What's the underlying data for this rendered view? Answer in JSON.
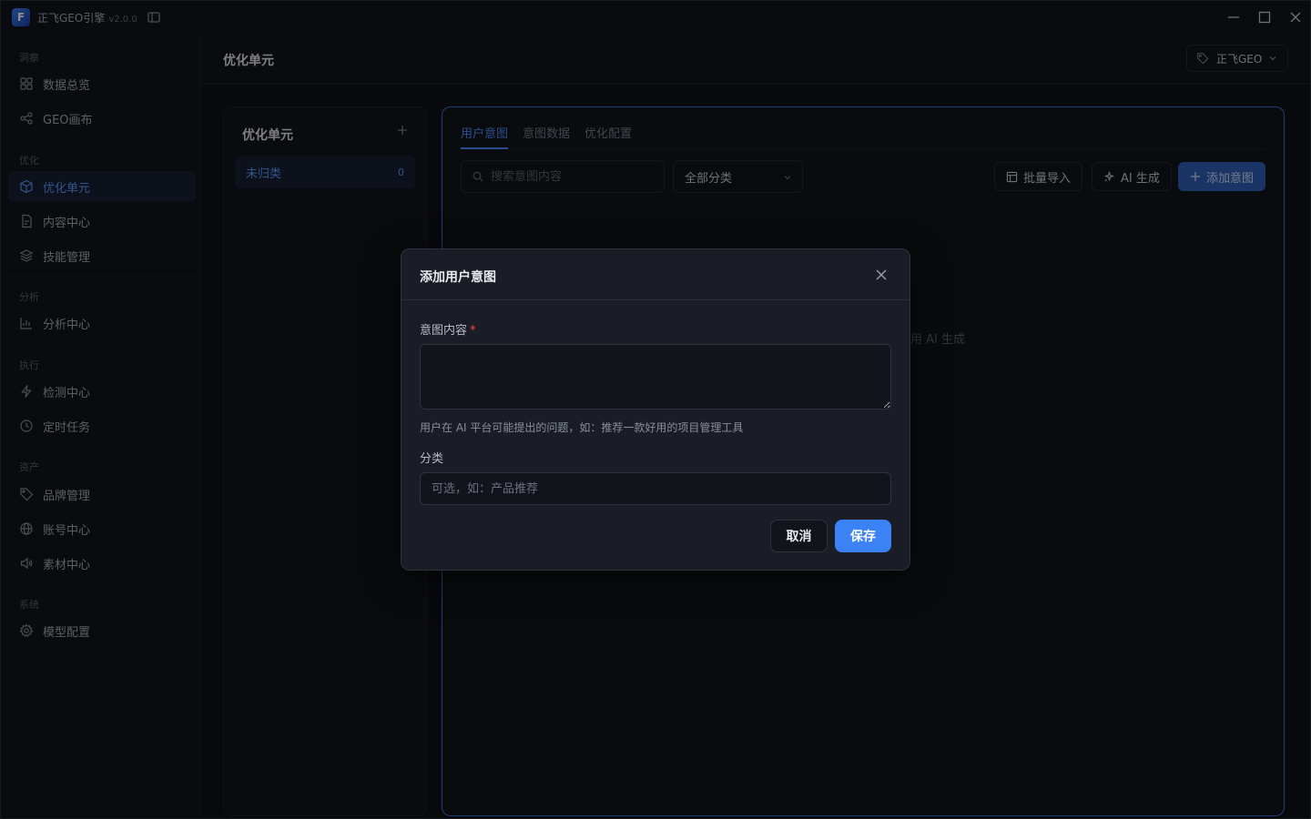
{
  "app": {
    "title": "正飞GEO引擎",
    "version": "v2.0.0",
    "logo_letter": "F"
  },
  "colors": {
    "accent": "#3b82f6",
    "bg": "#0f1117",
    "panel": "#12141b",
    "required": "#ef4444"
  },
  "sidebar": {
    "sections": [
      {
        "label": "洞察",
        "items": [
          {
            "label": "数据总览",
            "icon": "grid-icon"
          },
          {
            "label": "GEO画布",
            "icon": "share-nodes-icon"
          }
        ]
      },
      {
        "label": "优化",
        "items": [
          {
            "label": "优化单元",
            "icon": "cube-icon",
            "active": true
          },
          {
            "label": "内容中心",
            "icon": "document-icon"
          },
          {
            "label": "技能管理",
            "icon": "layers-icon"
          }
        ]
      },
      {
        "label": "分析",
        "items": [
          {
            "label": "分析中心",
            "icon": "bar-chart-icon"
          }
        ]
      },
      {
        "label": "执行",
        "items": [
          {
            "label": "检测中心",
            "icon": "bolt-icon"
          },
          {
            "label": "定时任务",
            "icon": "clock-icon"
          }
        ]
      },
      {
        "label": "资产",
        "items": [
          {
            "label": "品牌管理",
            "icon": "tag-icon"
          },
          {
            "label": "账号中心",
            "icon": "globe-icon"
          },
          {
            "label": "素材中心",
            "icon": "speaker-icon"
          }
        ]
      },
      {
        "label": "系统",
        "items": [
          {
            "label": "模型配置",
            "icon": "gear-icon"
          }
        ]
      }
    ]
  },
  "header": {
    "title": "优化单元",
    "brand_select": "正飞GEO"
  },
  "units_panel": {
    "title": "优化单元",
    "items": [
      {
        "label": "未归类",
        "count": "0"
      }
    ]
  },
  "main": {
    "tabs": [
      {
        "label": "用户意图",
        "active": true
      },
      {
        "label": "意图数据"
      },
      {
        "label": "优化配置"
      }
    ],
    "search_placeholder": "搜索意图内容",
    "category_select": "全部分类",
    "batch_import": "批量导入",
    "ai_generate": "AI 生成",
    "add_intent": "添加意图",
    "empty_hint_partial": "用 AI 生成"
  },
  "modal": {
    "title": "添加用户意图",
    "content_label": "意图内容",
    "required_mark": "*",
    "content_value": "",
    "content_hint": "用户在 AI 平台可能提出的问题，如：推荐一款好用的项目管理工具",
    "category_label": "分类",
    "category_placeholder": "可选，如：产品推荐",
    "cancel": "取消",
    "save": "保存"
  }
}
